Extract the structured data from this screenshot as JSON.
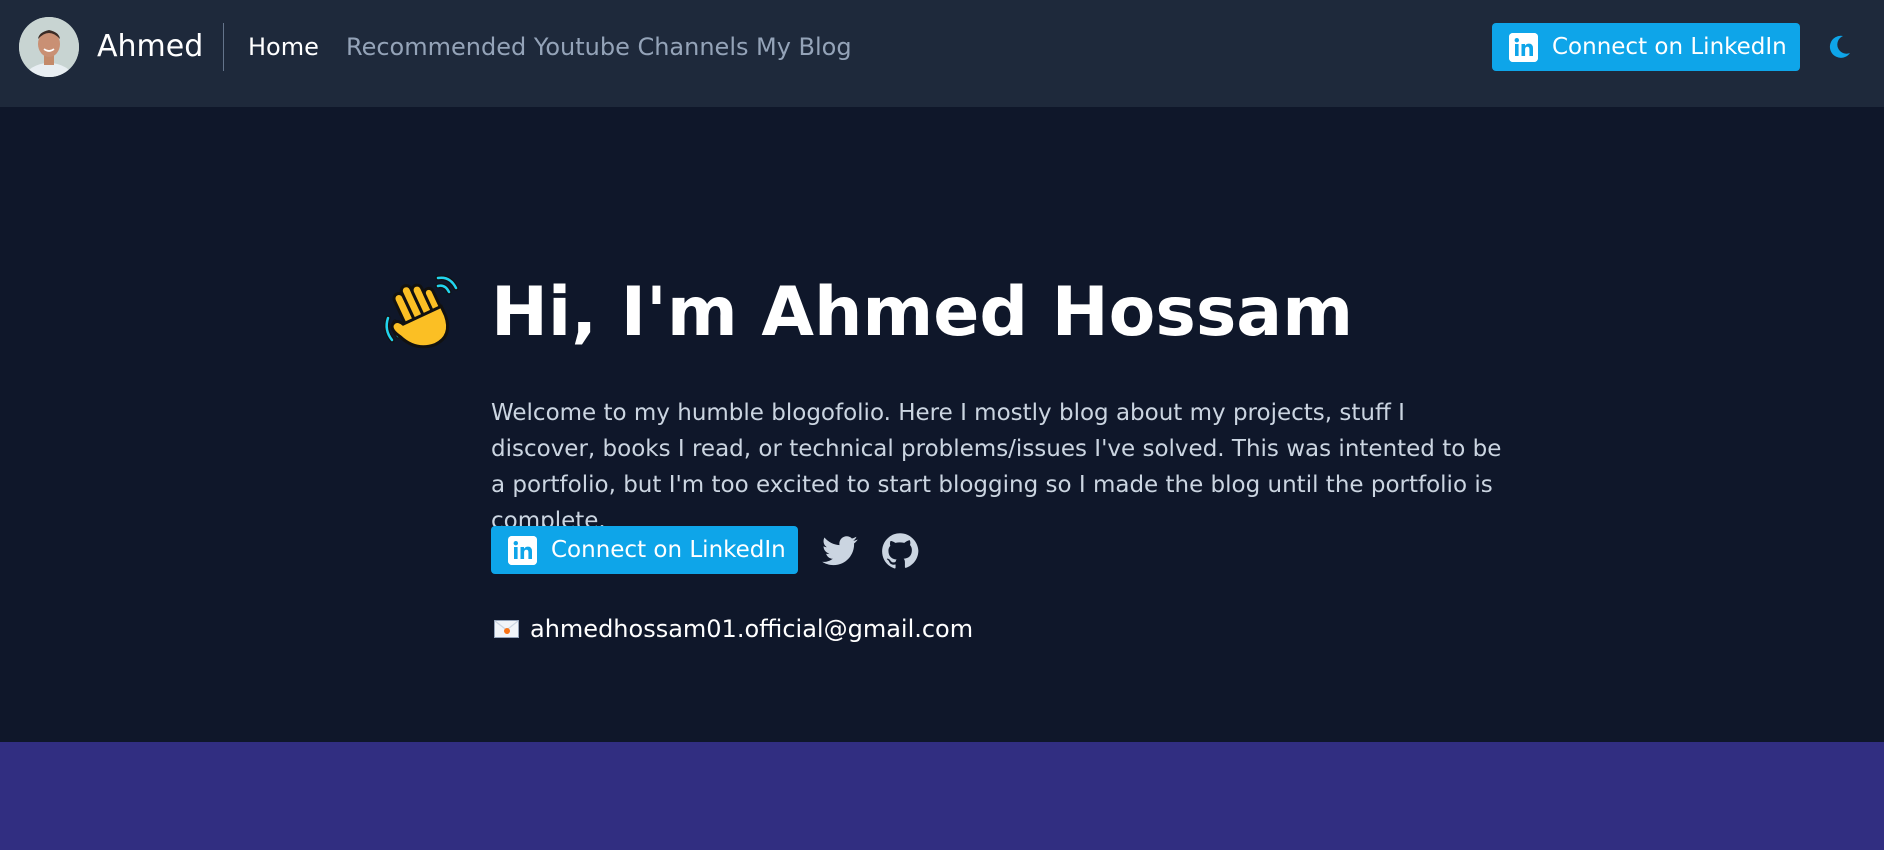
{
  "header": {
    "brand": "Ahmed",
    "nav": [
      {
        "label": "Home",
        "active": true
      },
      {
        "label": "Recommended Youtube Channels",
        "active": false
      },
      {
        "label": "My Blog",
        "active": false
      }
    ],
    "linkedin_label": "Connect on LinkedIn",
    "icons": [
      "avatar",
      "linkedin-icon",
      "moon-icon"
    ]
  },
  "hero": {
    "title": "Hi, I'm Ahmed Hossam",
    "intro": "Welcome to my humble blogofolio. Here I mostly blog about my projects, stuff I discover, books I read, or technical problems/issues I've solved. This was intented to be a portfolio, but I'm too excited to start blogging so I made the blog until the portfolio is complete.",
    "linkedin_label": "Connect on LinkedIn",
    "email": "ahmedhossam01.official@gmail.com",
    "icons": [
      "waving-hand-icon",
      "twitter-icon",
      "github-icon",
      "envelope-icon"
    ]
  },
  "colors": {
    "header_bg": "#1e293b",
    "page_bg": "#0f172a",
    "accent": "#0ea5e9",
    "next_section_bg": "#312e81"
  }
}
